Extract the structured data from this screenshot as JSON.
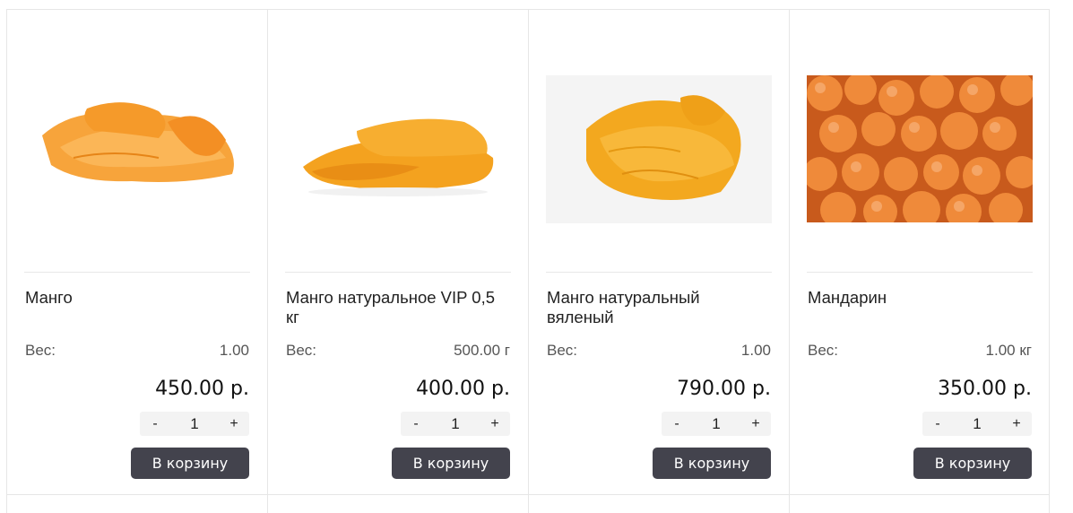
{
  "products": [
    {
      "name": "Манго",
      "weight_label": "Вес:",
      "weight_value": "1.00",
      "price": "450.00 р.",
      "qty_minus": "-",
      "qty": "1",
      "qty_plus": "+",
      "cart_label": "В корзину"
    },
    {
      "name": "Манго натуральное VIP 0,5 кг",
      "weight_label": "Вес:",
      "weight_value": "500.00 г",
      "price": "400.00 р.",
      "qty_minus": "-",
      "qty": "1",
      "qty_plus": "+",
      "cart_label": "В корзину"
    },
    {
      "name": "Манго натуральный вяленый",
      "weight_label": "Вес:",
      "weight_value": "1.00",
      "price": "790.00 р.",
      "qty_minus": "-",
      "qty": "1",
      "qty_plus": "+",
      "cart_label": "В корзину"
    },
    {
      "name": "Мандарин",
      "weight_label": "Вес:",
      "weight_value": "1.00 кг",
      "price": "350.00 р.",
      "qty_minus": "-",
      "qty": "1",
      "qty_plus": "+",
      "cart_label": "В корзину"
    }
  ],
  "colors": {
    "button_bg": "#43434d",
    "button_text": "#ffffff",
    "mango": "#f5a623",
    "mandarin": "#e8782a"
  }
}
